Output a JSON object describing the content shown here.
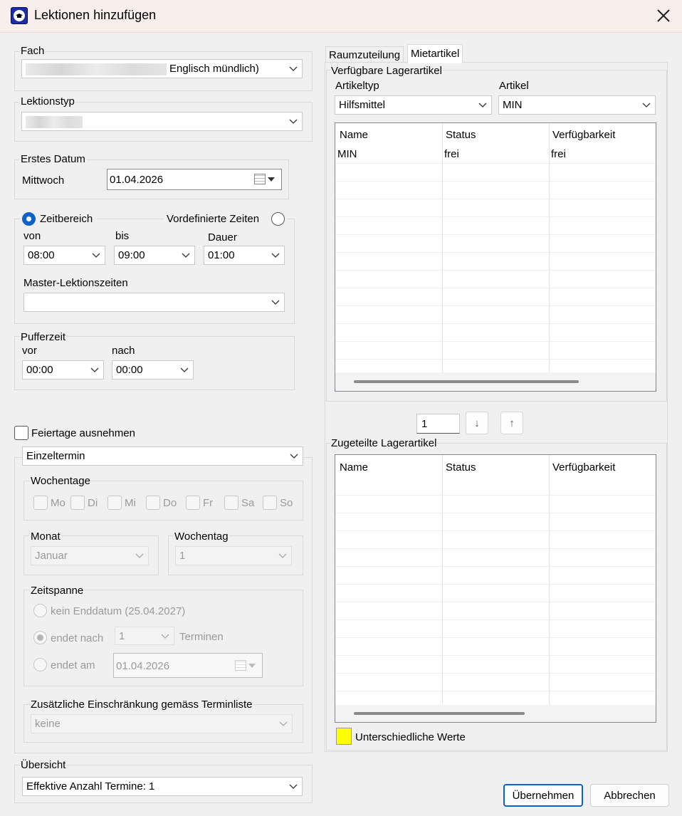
{
  "window": {
    "title": "Lektionen hinzufügen"
  },
  "fach": {
    "label": "Fach",
    "value": "Englisch mündlich)"
  },
  "lektionstyp": {
    "label": "Lektionstyp",
    "value": ""
  },
  "erstes_datum": {
    "label": "Erstes Datum",
    "weekday": "Mittwoch",
    "date": "01.04.2026"
  },
  "zeit": {
    "zeitbereich_label": "Zeitbereich",
    "vordefiniert_label": "Vordefinierte Zeiten",
    "von_label": "von",
    "von_value": "08:00",
    "bis_label": "bis",
    "bis_value": "09:00",
    "dauer_label": "Dauer",
    "dauer_value": "01:00",
    "master_label": "Master-Lektionszeiten",
    "master_value": ""
  },
  "puffer": {
    "label": "Pufferzeit",
    "vor_label": "vor",
    "vor_value": "00:00",
    "nach_label": "nach",
    "nach_value": "00:00"
  },
  "feiertage": {
    "label": "Feiertage ausnehmen",
    "checked": false
  },
  "wiederholung": {
    "mode_value": "Einzeltermin",
    "wochentage_label": "Wochentage",
    "days": [
      "Mo",
      "Di",
      "Mi",
      "Do",
      "Fr",
      "Sa",
      "So"
    ],
    "monat_label": "Monat",
    "monat_value": "Januar",
    "wochentag_label": "Wochentag",
    "wochentag_value": "1",
    "zeitspanne_label": "Zeitspanne",
    "kein_enddatum": "kein Enddatum (25.04.2027)",
    "endet_nach": "endet nach",
    "endet_nach_value": "1",
    "terminen": "Terminen",
    "endet_am": "endet am",
    "endet_am_value": "01.04.2026",
    "einschraenkung_label": "Zusätzliche Einschränkung gemäss Terminliste",
    "einschraenkung_value": "keine"
  },
  "uebersicht": {
    "label": "Übersicht",
    "value": "Effektive Anzahl Termine: 1"
  },
  "tabs": [
    {
      "label": "Raumzuteilung"
    },
    {
      "label": "Mietartikel"
    }
  ],
  "verfuegbar": {
    "label": "Verfügbare Lagerartikel",
    "artikeltyp_label": "Artikeltyp",
    "artikeltyp_value": "Hilfsmittel",
    "artikel_label": "Artikel",
    "artikel_value": "MIN",
    "columns": [
      "Name",
      "Status",
      "Verfügbarkeit"
    ],
    "row": {
      "name": "MIN",
      "status": "frei",
      "verfuegbarkeit": "frei"
    }
  },
  "mover": {
    "qty": "1",
    "down": "↓",
    "up": "↑"
  },
  "zugeteilt": {
    "label": "Zugeteilte Lagerartikel",
    "columns": [
      "Name",
      "Status",
      "Verfügbarkeit"
    ]
  },
  "legend": {
    "label": "Unterschiedliche Werte",
    "color": "#ffff00"
  },
  "buttons": {
    "apply": "Übernehmen",
    "cancel": "Abbrechen"
  },
  "colors": {
    "accent": "#0a63c8",
    "titlebar": "#f8efec"
  }
}
